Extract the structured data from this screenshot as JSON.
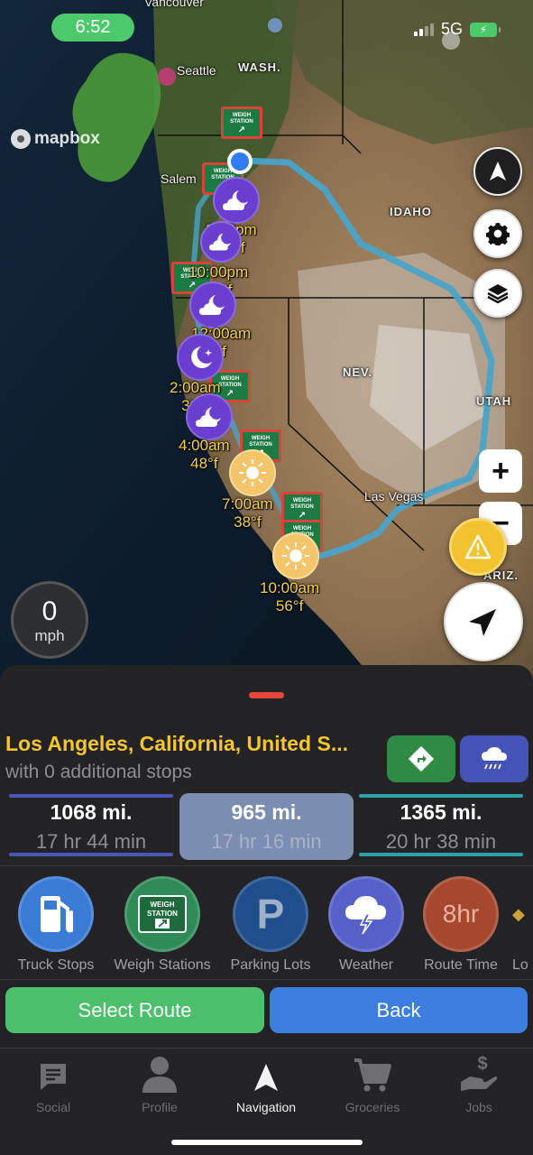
{
  "status_bar": {
    "time": "6:52",
    "network": "5G"
  },
  "map": {
    "attribution": "mapbox",
    "city_labels": [
      "Vancouver",
      "Seattle",
      "Salem",
      "Las Vegas"
    ],
    "state_labels": [
      "WASH.",
      "IDAHO",
      "NEV.",
      "UTAH",
      "ARIZ."
    ],
    "weather_markers": [
      {
        "time": "8:00pm",
        "temp": "36°f",
        "icon": "cloud-moon-icon"
      },
      {
        "time": "10:00pm",
        "temp": "27°f",
        "icon": "cloud-moon-icon"
      },
      {
        "time": "12:00am",
        "temp": "°f",
        "icon": "cloud-moon-icon"
      },
      {
        "time": "2:00am",
        "temp": "33°f",
        "icon": "moon-stars-icon"
      },
      {
        "time": "4:00am",
        "temp": "48°f",
        "icon": "cloud-moon-icon"
      },
      {
        "time": "7:00am",
        "temp": "38°f",
        "icon": "sun-icon"
      },
      {
        "time": "10:00am",
        "temp": "56°f",
        "icon": "sun-icon"
      }
    ],
    "weigh_station_sign": "WEIGH STATION",
    "speed": {
      "value": "0",
      "unit": "mph"
    },
    "zoom_in": "+",
    "zoom_out": "−",
    "colors": {
      "route": "#4aa3c8",
      "accent_yellow": "#f5c531"
    }
  },
  "sheet": {
    "destination": "Los Angeles, California, United S...",
    "stops": "with 0 additional stops",
    "routes": [
      {
        "miles": "1068 mi.",
        "time": "17 hr 44 min",
        "color": "#4a56b8",
        "selected": false
      },
      {
        "miles": "965 mi.",
        "time": "17 hr 16 min",
        "color": "#7b8db0",
        "selected": true
      },
      {
        "miles": "1365 mi.",
        "time": "20 hr 38 min",
        "color": "#2aa3a8",
        "selected": false
      }
    ],
    "categories": [
      {
        "label": "Truck Stops",
        "icon": "fuel-pump-icon",
        "color": "#3a7bd5"
      },
      {
        "label": "Weigh Stations",
        "icon": "weigh-station-icon",
        "color": "#2e8b57"
      },
      {
        "label": "Parking Lots",
        "icon": "parking-icon",
        "color": "#1f4e8c"
      },
      {
        "label": "Weather",
        "icon": "storm-cloud-icon",
        "color": "#5560c8"
      },
      {
        "label": "Route Time",
        "icon": "stopwatch-icon",
        "color": "#a6482e"
      },
      {
        "label": "Lo",
        "icon": "partial-icon",
        "color": "#3a3a3c"
      }
    ],
    "route_time_value": "8hr",
    "select_route": "Select Route",
    "back": "Back"
  },
  "tabs": [
    {
      "label": "Social",
      "icon": "chat-icon",
      "active": false
    },
    {
      "label": "Profile",
      "icon": "person-icon",
      "active": false
    },
    {
      "label": "Navigation",
      "icon": "navigation-arrow-icon",
      "active": true
    },
    {
      "label": "Groceries",
      "icon": "cart-icon",
      "active": false
    },
    {
      "label": "Jobs",
      "icon": "money-hand-icon",
      "active": false
    }
  ]
}
